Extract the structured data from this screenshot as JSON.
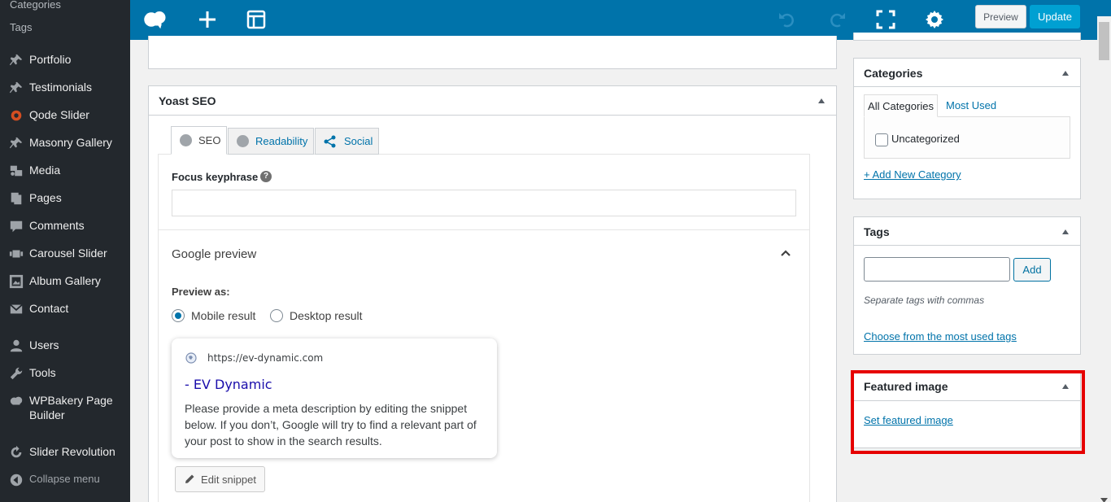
{
  "sidebar": {
    "submenu": [
      "Categories",
      "Tags"
    ],
    "items": [
      {
        "label": "Portfolio",
        "icon": "pin-icon"
      },
      {
        "label": "Testimonials",
        "icon": "pin-icon"
      },
      {
        "label": "Qode Slider",
        "icon": "circle-icon"
      },
      {
        "label": "Masonry Gallery",
        "icon": "pin-icon"
      },
      {
        "label": "Media",
        "icon": "media-icon"
      },
      {
        "label": "Pages",
        "icon": "pages-icon"
      },
      {
        "label": "Comments",
        "icon": "comment-icon"
      },
      {
        "label": "Carousel Slider",
        "icon": "slider-icon"
      },
      {
        "label": "Album Gallery",
        "icon": "gallery-icon"
      },
      {
        "label": "Contact",
        "icon": "mail-icon"
      },
      {
        "label": "Users",
        "icon": "user-icon"
      },
      {
        "label": "Tools",
        "icon": "wrench-icon"
      },
      {
        "label": "WPBakery Page",
        "label2": "Builder",
        "icon": "cloud-icon"
      },
      {
        "label": "Slider Revolution",
        "icon": "refresh-icon"
      }
    ],
    "collapse_label": "Collapse menu"
  },
  "toolbar": {
    "preview_label": "Preview",
    "update_label": "Update"
  },
  "yoast": {
    "title": "Yoast SEO",
    "tabs": [
      {
        "label": "SEO"
      },
      {
        "label": "Readability"
      },
      {
        "label": "Social"
      }
    ],
    "focus_label": "Focus keyphrase",
    "help_glyph": "?",
    "focus_value": "",
    "google_preview_title": "Google preview",
    "preview_as_label": "Preview as:",
    "mobile_label": "Mobile result",
    "desktop_label": "Desktop result",
    "snippet": {
      "url": "https://ev-dynamic.com",
      "title": "- EV Dynamic",
      "description": "Please provide a meta description by editing the snippet below. If you don’t, Google will try to find a relevant part of your post to show in the search results."
    },
    "edit_snippet_label": "Edit snippet"
  },
  "categories": {
    "title": "Categories",
    "tab_all": "All Categories",
    "tab_most_used": "Most Used",
    "items": [
      {
        "label": "Uncategorized",
        "checked": false
      }
    ],
    "add_link": "+ Add New Category"
  },
  "tags": {
    "title": "Tags",
    "input_value": "",
    "add_label": "Add",
    "hint": "Separate tags with commas",
    "choose_link": "Choose from the most used tags"
  },
  "featured_image": {
    "title": "Featured image",
    "set_link": "Set featured image"
  },
  "colors": {
    "admin_bar": "#23282d",
    "toolbar": "#0073aa",
    "update": "#00a0d2",
    "highlight": "#e60000"
  }
}
